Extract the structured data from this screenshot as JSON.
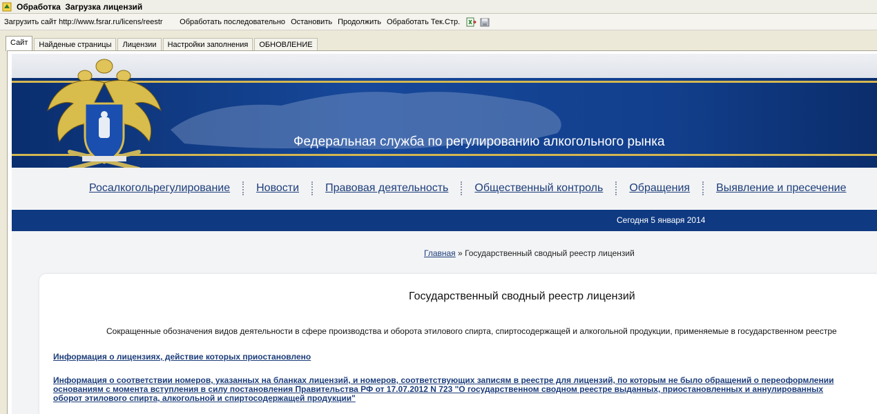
{
  "window": {
    "title": "Обработка  Загрузка лицензий"
  },
  "toolbar": {
    "load_site": "Загрузить сайт",
    "url": "http://www.fsrar.ru/licens/reestr",
    "process_seq": "Обработать последовательно",
    "stop": "Остановить",
    "continue": "Продолжить",
    "process_current": "Обработать Тек.Стр.",
    "icons": [
      "export-excel-icon",
      "disk-icon"
    ]
  },
  "tabs": [
    "Сайт",
    "Найденые страницы",
    "Лицензии",
    "Настройки заполнения",
    "ОБНОВЛЕНИЕ"
  ],
  "site": {
    "banner_title": "Федеральная служба по регулированию алкогольного рынка",
    "nav": [
      "Росалкогольрегулирование",
      "Новости",
      "Правовая деятельность",
      "Общественный контроль",
      "Обращения",
      "Выявление и пресечение"
    ],
    "date": "Сегодня 5 января 2014",
    "breadcrumb": {
      "home": "Главная",
      "sep": "»",
      "current": "Государственный сводный реестр лицензий"
    },
    "page_title": "Государственный сводный реестр лицензий",
    "intro": "Сокращенные обозначения видов деятельности в сфере производства и оборота этилового спирта, спиртосодержащей и алкогольной продукции, применяемые в государственном реестре",
    "link_suspended": "Информация о лицензиях, действие которых приостановлено",
    "link_match": [
      "Информация о соответствии номеров, указанных на бланках лицензий, и номеров, соответствующих записям в реестре для лицензий, по которым не было обращений о переоформлении",
      "основаниям с момента вступления в силу постановления Правительства РФ от 17.07.2012 N 723 \"О государственном сводном реестре выданных, приостановленных и аннулированных",
      "оборот этилового спирта, алкогольной и спиртосодержащей продукции\""
    ]
  },
  "colors": {
    "brand_blue": "#0f3a82",
    "gold": "#d4b750",
    "link": "#1c3d7a"
  }
}
